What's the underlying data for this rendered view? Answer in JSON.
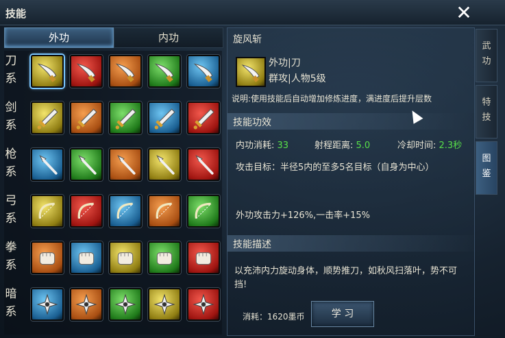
{
  "window": {
    "title": "技能",
    "close_glyph": "✕"
  },
  "tabs": [
    {
      "label": "外功",
      "active": true
    },
    {
      "label": "内功",
      "active": false
    }
  ],
  "rows": [
    {
      "label": [
        "刀",
        "系"
      ],
      "icon": "blade-icon",
      "colors": [
        "yellow",
        "red",
        "orange",
        "green",
        "blue"
      ],
      "selected": 0
    },
    {
      "label": [
        "剑",
        "系"
      ],
      "icon": "sword-icon",
      "colors": [
        "yellow",
        "orange",
        "green",
        "blue",
        "red"
      ],
      "selected": -1
    },
    {
      "label": [
        "枪",
        "系"
      ],
      "icon": "spear-icon",
      "colors": [
        "blue",
        "green",
        "orange",
        "yellow",
        "red"
      ],
      "selected": -1
    },
    {
      "label": [
        "弓",
        "系"
      ],
      "icon": "bow-icon",
      "colors": [
        "yellow",
        "red",
        "blue",
        "orange",
        "green"
      ],
      "selected": -1
    },
    {
      "label": [
        "拳",
        "系"
      ],
      "icon": "fist-icon",
      "colors": [
        "orange",
        "blue",
        "yellow",
        "green",
        "red"
      ],
      "selected": -1
    },
    {
      "label": [
        "暗",
        "系"
      ],
      "icon": "dart-icon",
      "colors": [
        "blue",
        "orange",
        "green",
        "yellow",
        "red"
      ],
      "selected": -1
    }
  ],
  "detail": {
    "skill_name": "旋风斩",
    "type_line": "外功|刀",
    "scope_line": "群攻|人物5级",
    "description": "说明:使用技能后自动增加修炼进度，满进度后提升层数",
    "section_effect": "技能功效",
    "stats": [
      {
        "label": "内功消耗:",
        "value": "33"
      },
      {
        "label": "射程距离:",
        "value": "5.0"
      },
      {
        "label": "冷却时间:",
        "value": "2.3秒"
      }
    ],
    "target": "攻击目标：半径5内的至多5名目标（自身为中心）",
    "bonus": "外功攻击力+126%,一击率+15%",
    "section_desc": "技能描述",
    "story": "以充沛内力旋动身体，顺势推刀，如秋风扫落叶，势不可挡!",
    "cost": "消耗：1620墨币",
    "learn_label": "学 习",
    "accent_green": "#58e049"
  },
  "side_tabs": [
    {
      "chars": [
        "武",
        "功"
      ],
      "active": false
    },
    {
      "chars": [
        "特",
        "技"
      ],
      "active": false
    },
    {
      "chars": [
        "图",
        "鉴"
      ],
      "active": true
    }
  ]
}
